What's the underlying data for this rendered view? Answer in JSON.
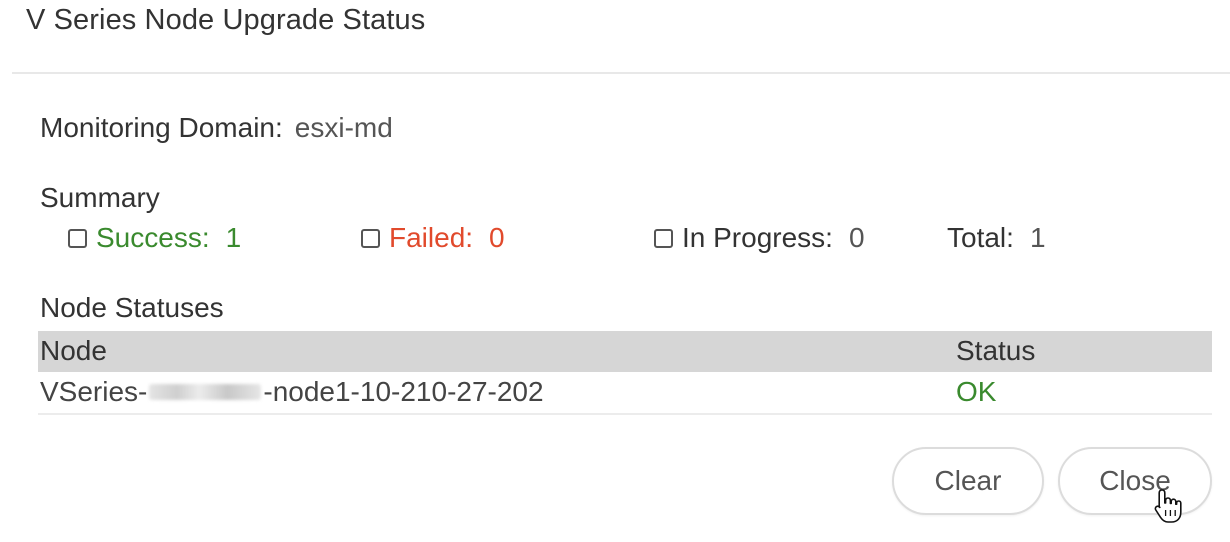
{
  "dialog": {
    "title": "V Series Node Upgrade Status"
  },
  "monitoring_domain": {
    "label": "Monitoring Domain:",
    "value": "esxi-md"
  },
  "summary": {
    "label": "Summary",
    "success": {
      "label": "Success:",
      "value": "1",
      "color": "#3a8a2e"
    },
    "failed": {
      "label": "Failed:",
      "value": "0",
      "color": "#e14a2c"
    },
    "in_progress": {
      "label": "In Progress:",
      "value": "0"
    },
    "total": {
      "label": "Total:",
      "value": "1"
    }
  },
  "node_statuses": {
    "label": "Node Statuses",
    "columns": [
      "Node",
      "Status"
    ],
    "rows": [
      {
        "node_prefix": "VSeries-",
        "node_suffix": "-node1-10-210-27-202",
        "status": "OK"
      }
    ]
  },
  "buttons": {
    "clear": "Clear",
    "close": "Close"
  },
  "colors": {
    "ok": "#3a8a2e",
    "header_bg": "#d6d6d6"
  }
}
